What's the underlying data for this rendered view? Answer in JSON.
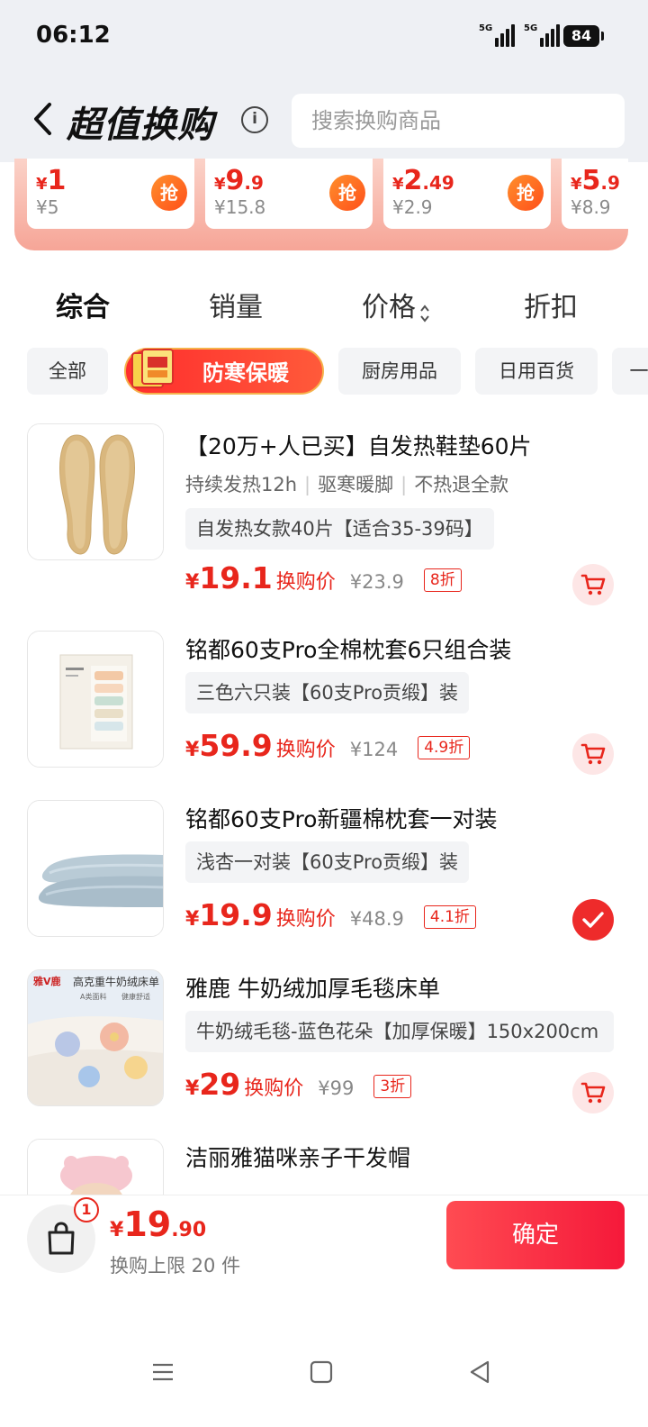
{
  "status_bar": {
    "time": "06:12",
    "network1": "5G",
    "network2": "5G",
    "battery": "84"
  },
  "header": {
    "title": "超值换购",
    "info_glyph": "i",
    "search_placeholder": "搜索换购商品"
  },
  "promo_cards": [
    {
      "price_int": "1",
      "price_dec": "",
      "orig": "¥5",
      "btn": "抢"
    },
    {
      "price_int": "9",
      "price_dec": ".9",
      "orig": "¥15.8",
      "btn": "抢"
    },
    {
      "price_int": "2",
      "price_dec": ".49",
      "orig": "¥2.9",
      "btn": "抢"
    },
    {
      "price_int": "5",
      "price_dec": ".9",
      "orig": "¥8.9",
      "btn": ""
    }
  ],
  "currency": "¥",
  "sort_tabs": [
    "综合",
    "销量",
    "价格",
    "折扣"
  ],
  "categories": [
    "全部",
    "防寒保暖",
    "厨房用品",
    "日用百货",
    "一"
  ],
  "products": [
    {
      "title": "【20万+人已买】自发热鞋垫60片",
      "tags": [
        "持续发热12h",
        "驱寒暖脚",
        "不热退全款"
      ],
      "spec": "自发热女款40片【适合35-39码】",
      "price": "19.1",
      "price_label": "换购价",
      "orig": "¥23.9",
      "discount": "8折",
      "selected": false
    },
    {
      "title": "铭都60支Pro全棉枕套6只组合装",
      "tags": [],
      "spec": "三色六只装【60支Pro贡缎】装",
      "price": "59.9",
      "price_label": "换购价",
      "orig": "¥124",
      "discount": "4.9折",
      "selected": false
    },
    {
      "title": "铭都60支Pro新疆棉枕套一对装",
      "tags": [],
      "spec": "浅杏一对装【60支Pro贡缎】装",
      "price": "19.9",
      "price_label": "换购价",
      "orig": "¥48.9",
      "discount": "4.1折",
      "selected": true
    },
    {
      "title": "雅鹿 牛奶绒加厚毛毯床单",
      "tags": [],
      "spec": "牛奶绒毛毯-蓝色花朵【加厚保暖】150x200cm",
      "price": "29",
      "price_label": "换购价",
      "orig": "¥99",
      "discount": "3折",
      "selected": false,
      "thumb_brand": "雅V鹿",
      "thumb_caption": "高克重牛奶绒床单",
      "thumb_sub1": "A类面料",
      "thumb_sub2": "健康舒适"
    },
    {
      "title": "洁丽雅猫咪亲子干发帽",
      "tags": [],
      "spec": "",
      "price": "",
      "price_label": "",
      "orig": "",
      "discount": "",
      "selected": false
    }
  ],
  "bottom": {
    "badge_count": "1",
    "total_int": "19",
    "total_dec": ".90",
    "limit_text": "换购上限 20 件",
    "confirm": "确定"
  },
  "icons": {
    "back": "chevron-left-icon",
    "info": "info-icon",
    "grab": "grab-badge",
    "cart": "cart-icon",
    "check": "check-icon",
    "bag": "shopping-bag-icon",
    "nav_menu": "menu-icon",
    "nav_home": "home-square-icon",
    "nav_back": "back-triangle-icon"
  },
  "colors": {
    "accent": "#e8261c",
    "bg": "#eef0f4",
    "promo_bg": "#f6a597"
  }
}
